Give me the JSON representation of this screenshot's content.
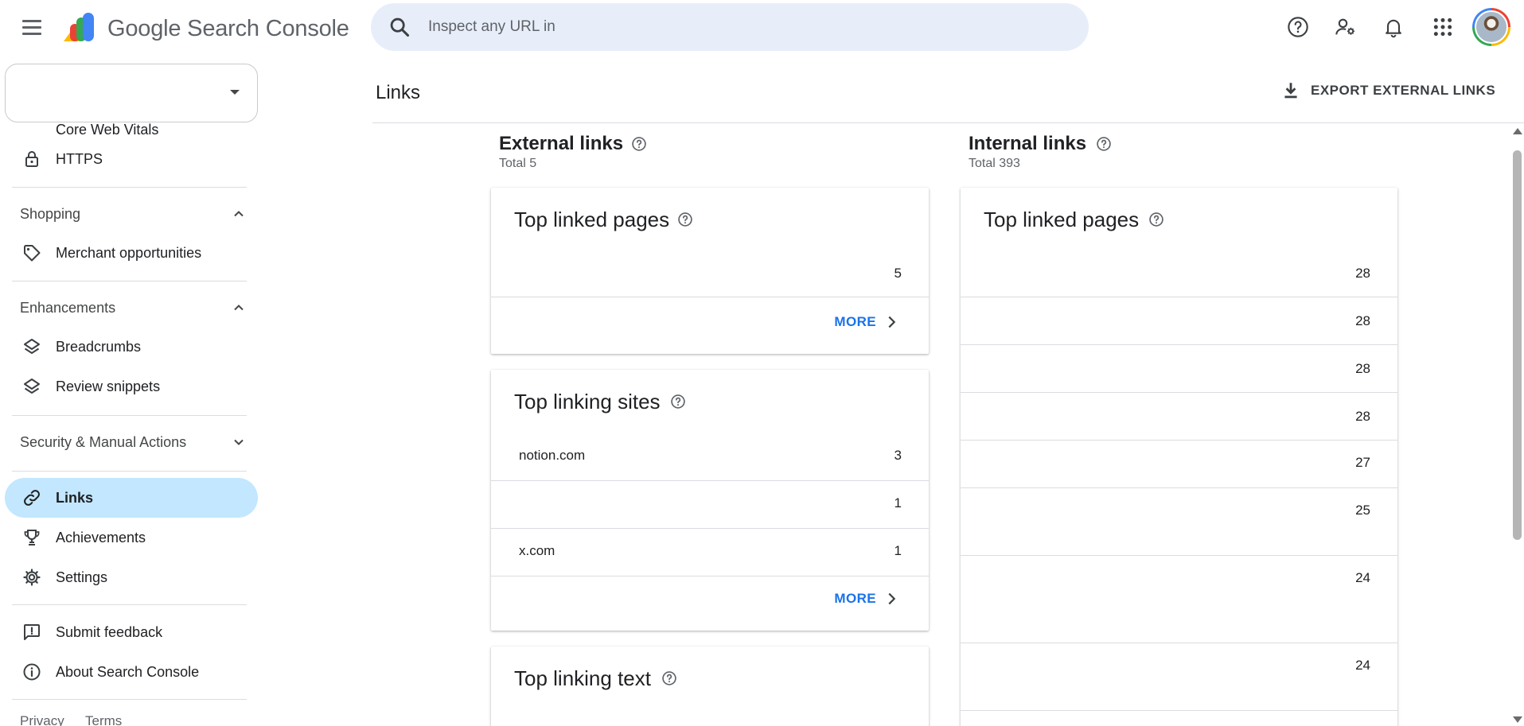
{
  "app": {
    "brand": "Google Search Console"
  },
  "search": {
    "placeholder": "Inspect any URL in"
  },
  "sidebar": {
    "partial_item": "Core Web Vitals",
    "https": "HTTPS",
    "shopping": "Shopping",
    "merchant": "Merchant opportunities",
    "enhancements": "Enhancements",
    "breadcrumbs": "Breadcrumbs",
    "review_snippets": "Review snippets",
    "security": "Security & Manual Actions",
    "links": "Links",
    "achievements": "Achievements",
    "settings": "Settings",
    "feedback": "Submit feedback",
    "about": "About Search Console",
    "privacy": "Privacy",
    "terms": "Terms"
  },
  "page": {
    "title": "Links",
    "export_label": "EXPORT EXTERNAL LINKS"
  },
  "external": {
    "title": "External links",
    "total": "Total 5",
    "top_linked_pages": {
      "title": "Top linked pages",
      "rows": [
        {
          "label": "",
          "value": "5"
        }
      ],
      "more": "MORE"
    },
    "top_linking_sites": {
      "title": "Top linking sites",
      "rows": [
        {
          "label": "notion.com",
          "value": "3"
        },
        {
          "label": "",
          "value": "1"
        },
        {
          "label": "x.com",
          "value": "1"
        }
      ],
      "more": "MORE"
    },
    "top_linking_text": {
      "title": "Top linking text"
    }
  },
  "internal": {
    "title": "Internal links",
    "total": "Total 393",
    "top_linked_pages": {
      "title": "Top linked pages",
      "rows": [
        {
          "label": "",
          "value": "28"
        },
        {
          "label": "",
          "value": "28"
        },
        {
          "label": "",
          "value": "28"
        },
        {
          "label": "",
          "value": "28"
        },
        {
          "label": "",
          "value": "27"
        },
        {
          "label": "",
          "value": "25"
        },
        {
          "label": "",
          "value": "24"
        },
        {
          "label": "",
          "value": "24"
        }
      ]
    }
  },
  "colors": {
    "accent": "#1a73e8",
    "active_nav": "#c2e7ff",
    "search_bg": "#e8eef9"
  }
}
